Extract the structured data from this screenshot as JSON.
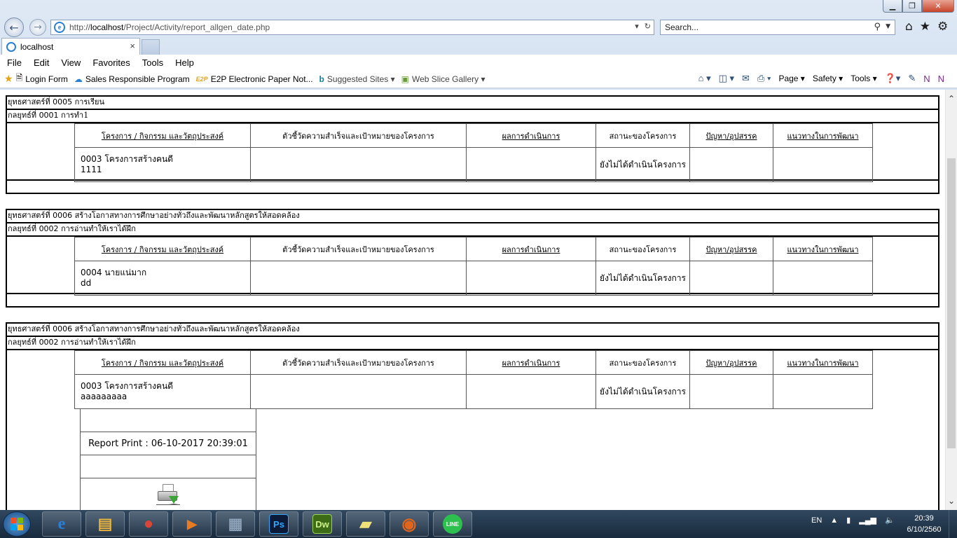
{
  "window": {
    "min_label": "▁",
    "max_label": "❐",
    "close_label": "✕"
  },
  "browser": {
    "url_host": "http://",
    "url_main": "localhost",
    "url_path": "/Project/Activity/report_allgen_date.php",
    "search_placeholder": "Search...",
    "tab_title": "localhost",
    "tab_close": "×"
  },
  "menu": [
    "File",
    "Edit",
    "View",
    "Favorites",
    "Tools",
    "Help"
  ],
  "favorites": [
    {
      "label": "Login Form",
      "icon": "page-icon"
    },
    {
      "label": "Sales Responsible Program",
      "icon": "cloud-icon"
    },
    {
      "label": "E2P  Electronic Paper Not...",
      "icon": "e2p-icon",
      "badge": "E2P"
    },
    {
      "label": "Suggested Sites ▾",
      "icon": "bing-icon"
    },
    {
      "label": "Web Slice Gallery ▾",
      "icon": "slice-icon"
    }
  ],
  "commands": [
    "Page ▾",
    "Safety ▾",
    "Tools ▾"
  ],
  "report": {
    "columns": [
      "โครงการ / กิจกรรม และวัตถุประสงค์",
      "ตัวชี้วัดความสำเร็จและเป้าหมายของโครงการ",
      "ผลการดำเนินการ",
      "สถานะของโครงการ",
      "ปัญหา/อุปสรรค",
      "แนวทางในการพัฒนา"
    ],
    "blocks": [
      {
        "strategy_prefix": "ยุทธศาสตร์ที่ ",
        "strategy_num": "0005",
        "strategy_name": " การเรียน",
        "tactic_prefix": "กลยุทธ์ที่ ",
        "tactic_num": "0001",
        "tactic_name": " การทำ1",
        "project_line1": "0003 โครงการสร้างคนดี",
        "project_line2": "1111",
        "status": "ยังไม่ได้ดำเนินโครงการ"
      },
      {
        "strategy_prefix": "ยุทธศาสตร์ที่ ",
        "strategy_num": "0006",
        "strategy_name": " สร้างโอกาสทางการศึกษาอย่างทั่วถึงและพัฒนาหลักสูตรให้สอดคล้อง",
        "tactic_prefix": "กลยุทธ์ที่ ",
        "tactic_num": "0002",
        "tactic_name": " การอ่านทำให้เราได้ฝึก",
        "project_line1": "0004 นายแน่มาก",
        "project_line2": "dd",
        "status": "ยังไม่ได้ดำเนินโครงการ"
      },
      {
        "strategy_prefix": "ยุทธศาสตร์ที่ ",
        "strategy_num": "0006",
        "strategy_name": " สร้างโอกาสทางการศึกษาอย่างทั่วถึงและพัฒนาหลักสูตรให้สอดคล้อง",
        "tactic_prefix": "กลยุทธ์ที่ ",
        "tactic_num": "0002",
        "tactic_name": " การอ่านทำให้เราได้ฝึก",
        "project_line1": "0003 โครงการสร้างคนดี",
        "project_line2": "aaaaaaaaa",
        "status": "ยังไม่ได้ดำเนินโครงการ"
      }
    ],
    "report_print": "Report Print : 06-10-2017 20:39:01"
  },
  "taskbar": {
    "lang": "EN",
    "time": "20:39",
    "date": "6/10/2560",
    "apps": [
      {
        "name": "ie-icon",
        "label": "e",
        "color": "#2a7fd4"
      },
      {
        "name": "explorer-icon",
        "label": "▤",
        "color": "#e7b43f"
      },
      {
        "name": "chrome-icon",
        "label": "●",
        "color": "#d8463a"
      },
      {
        "name": "media-icon",
        "label": "▶",
        "color": "#e77b24"
      },
      {
        "name": "calculator-icon",
        "label": "▦",
        "color": "#8da2b8"
      },
      {
        "name": "photoshop-icon",
        "label": "Ps",
        "color": "#0b1a36"
      },
      {
        "name": "dreamweaver-icon",
        "label": "Dw",
        "color": "#3d6b16"
      },
      {
        "name": "sticky-notes-icon",
        "label": "▰",
        "color": "#f0e07a"
      },
      {
        "name": "firefox-icon",
        "label": "◉",
        "color": "#e0661d"
      },
      {
        "name": "line-icon",
        "label": "LINE",
        "color": "#2ec04f"
      }
    ]
  }
}
